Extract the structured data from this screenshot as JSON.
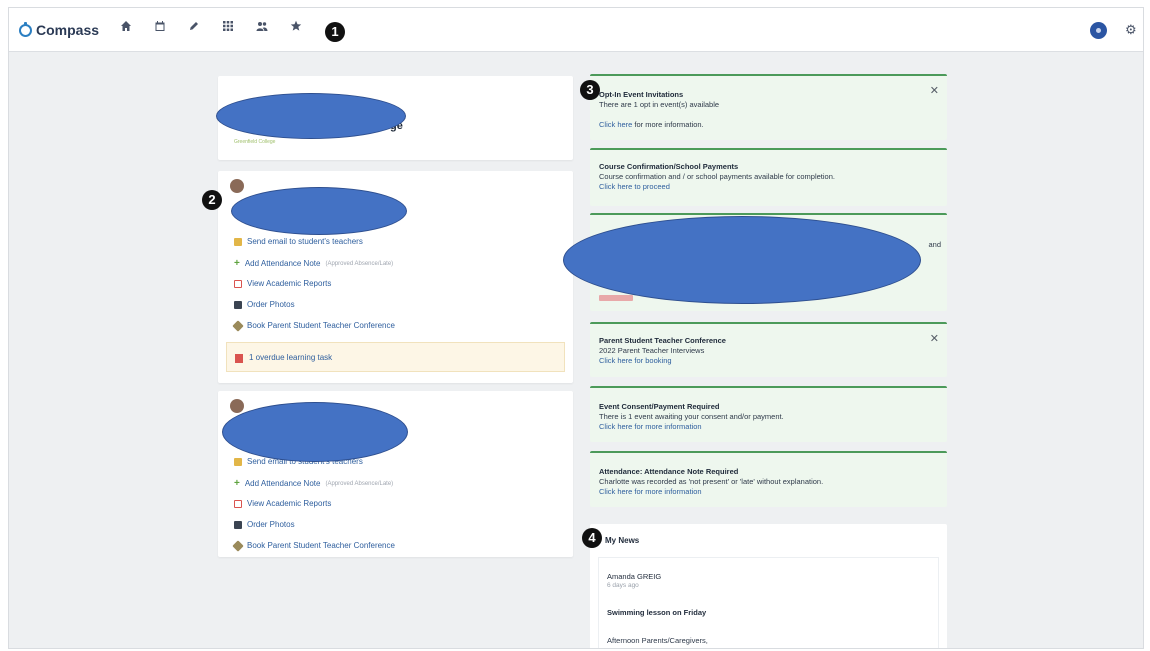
{
  "app": {
    "name": "Compass"
  },
  "topbar": {
    "nav_icons": [
      "home-icon",
      "calendar-icon",
      "pencil-icon",
      "grid-icon",
      "people-icon",
      "star-icon"
    ],
    "callout": "1"
  },
  "left": {
    "school_card": {
      "title_fragment": "ge",
      "subtitle": "Greenfield College"
    },
    "student1": {
      "callout": "2",
      "links": [
        {
          "label": "Send email to student's teachers",
          "note": ""
        },
        {
          "label": "Add Attendance Note",
          "note": "(Approved Absence/Late)"
        },
        {
          "label": "View Academic Reports",
          "note": ""
        },
        {
          "label": "Order Photos",
          "note": ""
        },
        {
          "label": "Book Parent Student Teacher Conference",
          "note": ""
        }
      ],
      "alert": "1 overdue learning task"
    },
    "student2": {
      "links": [
        {
          "label": "Send email to student's teachers",
          "note": ""
        },
        {
          "label": "Add Attendance Note",
          "note": "(Approved Absence/Late)"
        },
        {
          "label": "View Academic Reports",
          "note": ""
        },
        {
          "label": "Order Photos",
          "note": ""
        },
        {
          "label": "Book Parent Student Teacher Conference",
          "note": ""
        }
      ]
    }
  },
  "notices": {
    "callout": "3",
    "optin": {
      "title": "Opt-In Event Invitations",
      "body": "There are 1 opt in event(s) available",
      "link": "Click here",
      "rest": " for more information."
    },
    "course": {
      "title": "Course Confirmation/School Payments",
      "body": "Course confirmation and / or school payments available for completion.",
      "link": "Click here to proceed"
    },
    "hidden": {
      "tail": "and"
    },
    "pstc": {
      "title": "Parent Student Teacher Conference",
      "body": "2022 Parent Teacher Interviews",
      "link": "Click here for booking"
    },
    "consent": {
      "title": "Event Consent/Payment Required",
      "body": "There is 1 event awaiting your consent and/or payment.",
      "link": "Click here for more information"
    },
    "attendance": {
      "title": "Attendance: Attendance Note Required",
      "body": "Charlotte was recorded as 'not present' or 'late' without explanation.",
      "link": "Click here for more information"
    }
  },
  "news": {
    "callout": "4",
    "header": "My News",
    "author": "Amanda GREIG",
    "when": "6 days ago",
    "post_title": "Swimming lesson on Friday",
    "post_start": "Afternoon Parents/Caregivers,"
  },
  "colors": {
    "accent": "#2f5f9e",
    "notice_border": "#4c9a5a",
    "notice_bg": "#eef7ee",
    "redaction": "#4472c4"
  }
}
